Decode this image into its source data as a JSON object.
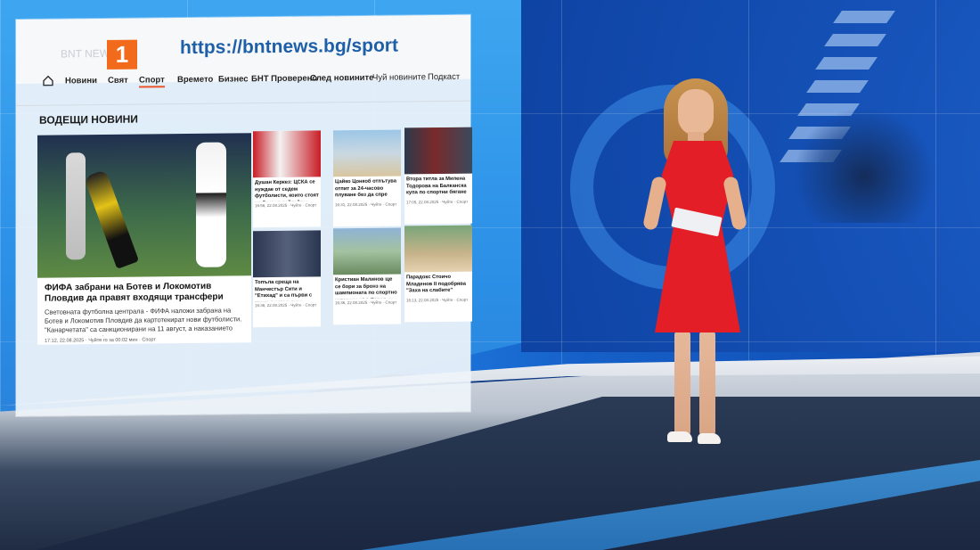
{
  "website": {
    "url": "https://bntnews.bg/sport",
    "logo_text": "1",
    "logo_ghost": "BNT NEWS",
    "nav": [
      "Новини",
      "Свят",
      "Спорт",
      "Времето",
      "Бизнес",
      "БНТ Проверено",
      "След новините",
      "Чуй новините",
      "Подкаст"
    ],
    "section_title": "ВОДЕЩИ НОВИНИ",
    "hero": {
      "title": "ФИФА забрани на Ботев и Локомотив Пловдив да правят входящи трансфери",
      "text": "Световната футболна централа - ФИФА наложи забрана на Ботев и Локомотив Пловдив да картотекират нови футболисти. \"Канарчетата\" са санкционирани на 11 август, а наказанието важи за три трансферни прозореца и е наложено заради неуредени задължения. От своя страна Локомотив Пловдив е...",
      "meta": "17:12, 22.08.2025   ·   Чуйте го за 00:02 мин   ·   Спорт"
    },
    "cards": [
      {
        "title": "Душан Керкез: ЦСКА се нуждае от седем футболисти, които стоят на бранен хайрайтер",
        "meta": "16:56, 22.08.2025 · Чуйте · Спорт"
      },
      {
        "title": "Цайко Цонкоб отпътува отпит за 24-часово плуване без да спре",
        "meta": "16:31, 22.08.2025 · Чуйте · Спорт"
      },
      {
        "title": "Втора титла за Милена Тодорова на Балканска купа по спортни бягане",
        "meta": "17:05, 22.08.2025 · Чуйте · Спорт"
      },
      {
        "title": "Топъла среща на Манчестър Сити и \"Етихад\" и са първи с трите точки и суха мрежа",
        "meta": "16:36, 22.08.2025 · Чуйте · Спорт"
      },
      {
        "title": "Кристиан Малинов ще се бори за бронз на шампионата по спортно катерене във Корея на 20 к.",
        "meta": "16:36, 22.08.2025 · Чуйте · Спорт"
      },
      {
        "title": "Парадокс Стоичо Младенов II подобрява \"Заха на слабите\"",
        "meta": "16:13, 22.08.2025 · Чуйте · Спорт"
      }
    ]
  },
  "colors": {
    "accent_orange": "#f26a1b",
    "url_blue": "#1e5fa8",
    "dress_red": "#e41e26"
  }
}
